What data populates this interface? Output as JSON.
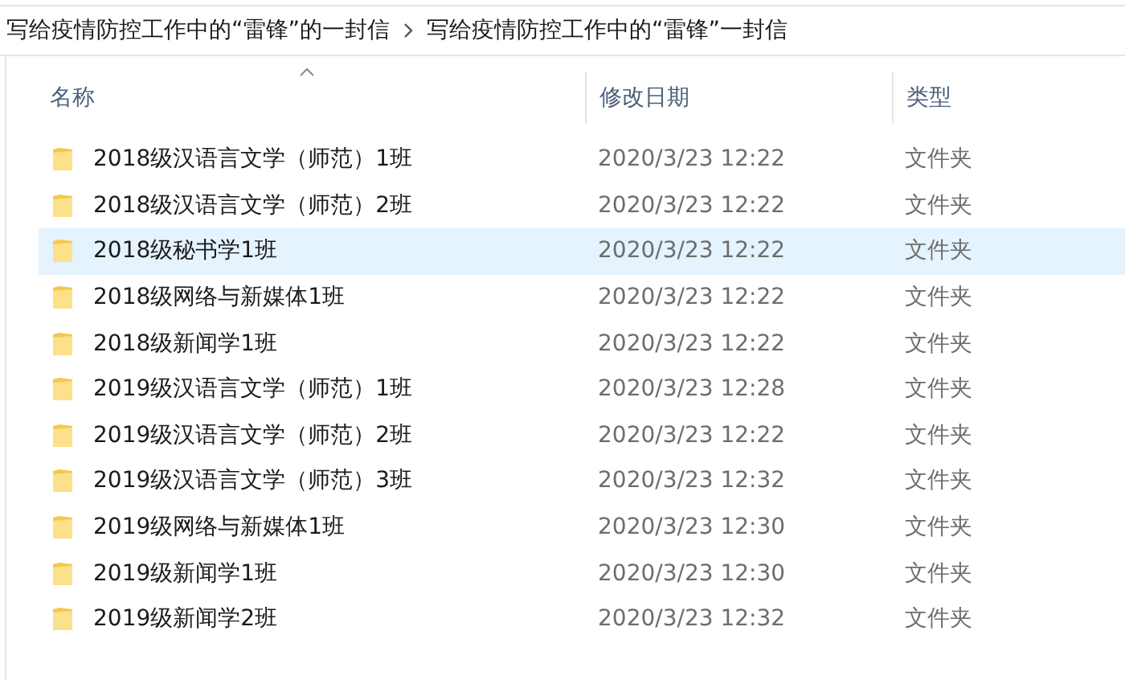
{
  "breadcrumb": [
    "写给疫情防控工作中的“雷锋”的一封信",
    "写给疫情防控工作中的“雷锋”一封信"
  ],
  "table": {
    "columns": [
      {
        "label": "名称",
        "sorted": true
      },
      {
        "label": "修改日期",
        "sorted": false
      },
      {
        "label": "类型",
        "sorted": false
      }
    ],
    "rows": [
      {
        "name": "2018级汉语言文学（师范）1班",
        "date": "2020/3/23 12:22",
        "type": "文件夹",
        "selected": false
      },
      {
        "name": "2018级汉语言文学（师范）2班",
        "date": "2020/3/23 12:22",
        "type": "文件夹",
        "selected": false
      },
      {
        "name": "2018级秘书学1班",
        "date": "2020/3/23 12:22",
        "type": "文件夹",
        "selected": true
      },
      {
        "name": "2018级网络与新媒体1班",
        "date": "2020/3/23 12:22",
        "type": "文件夹",
        "selected": false
      },
      {
        "name": "2018级新闻学1班",
        "date": "2020/3/23 12:22",
        "type": "文件夹",
        "selected": false
      },
      {
        "name": "2019级汉语言文学（师范）1班",
        "date": "2020/3/23 12:28",
        "type": "文件夹",
        "selected": false
      },
      {
        "name": "2019级汉语言文学（师范）2班",
        "date": "2020/3/23 12:22",
        "type": "文件夹",
        "selected": false
      },
      {
        "name": "2019级汉语言文学（师范）3班",
        "date": "2020/3/23 12:32",
        "type": "文件夹",
        "selected": false
      },
      {
        "name": "2019级网络与新媒体1班",
        "date": "2020/3/23 12:30",
        "type": "文件夹",
        "selected": false
      },
      {
        "name": "2019级新闻学1班",
        "date": "2020/3/23 12:30",
        "type": "文件夹",
        "selected": false
      },
      {
        "name": "2019级新闻学2班",
        "date": "2020/3/23 12:32",
        "type": "文件夹",
        "selected": false
      }
    ]
  }
}
